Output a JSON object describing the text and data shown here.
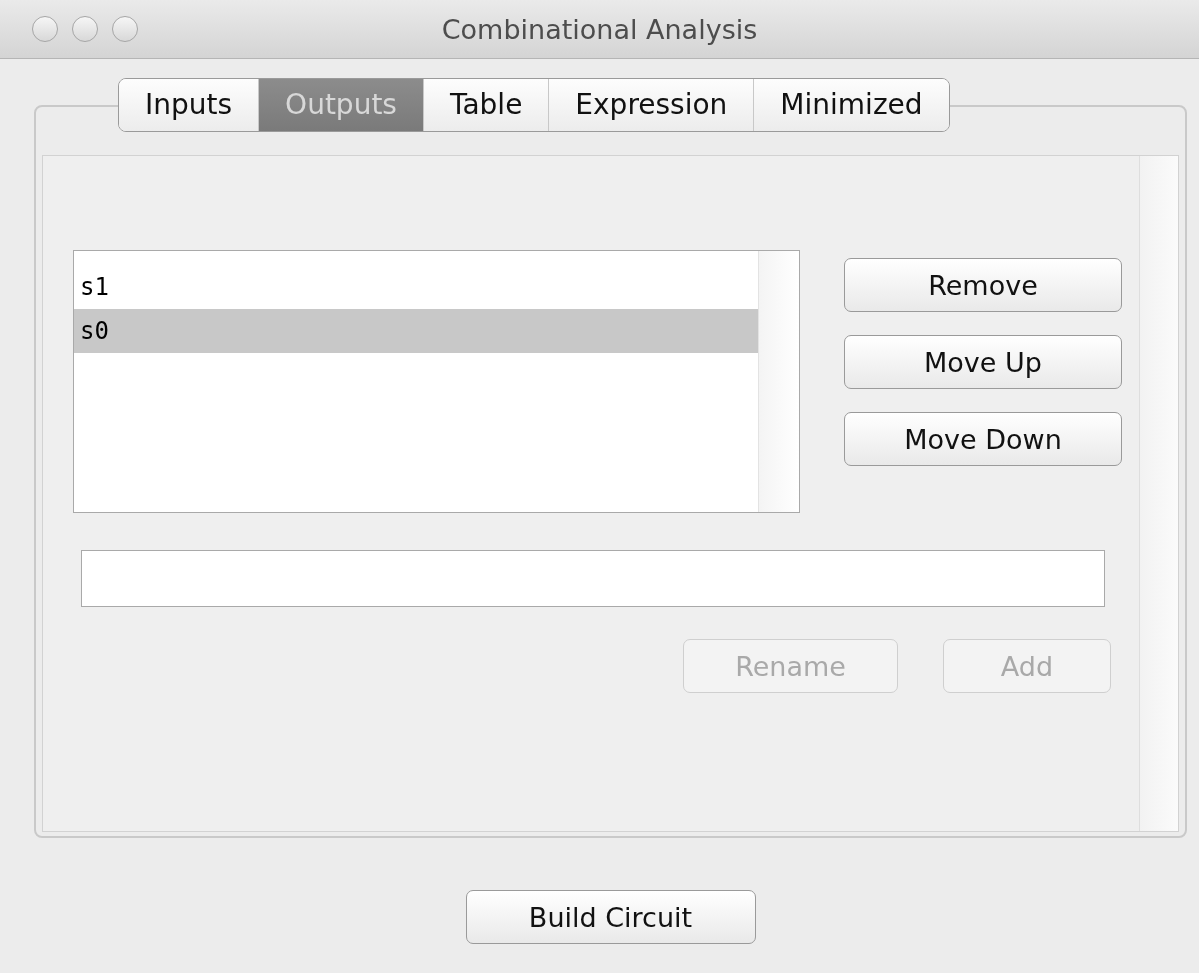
{
  "window": {
    "title": "Combinational Analysis"
  },
  "tabs": [
    {
      "label": "Inputs",
      "selected": false
    },
    {
      "label": "Outputs",
      "selected": true
    },
    {
      "label": "Table",
      "selected": false
    },
    {
      "label": "Expression",
      "selected": false
    },
    {
      "label": "Minimized",
      "selected": false
    }
  ],
  "list": {
    "items": [
      {
        "label": "s1",
        "selected": false
      },
      {
        "label": "s0",
        "selected": true
      }
    ]
  },
  "side_buttons": [
    {
      "label": "Remove",
      "disabled": false
    },
    {
      "label": "Move Up",
      "disabled": false
    },
    {
      "label": "Move Down",
      "disabled": false
    }
  ],
  "field_buttons": [
    {
      "label": "Rename",
      "disabled": true
    },
    {
      "label": "Add",
      "disabled": true
    }
  ],
  "footer_button": {
    "label": "Build Circuit"
  }
}
